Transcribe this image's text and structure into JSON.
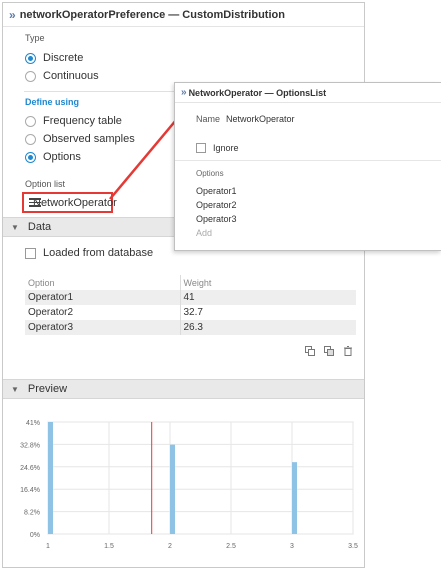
{
  "main_panel": {
    "title": "networkOperatorPreference — CustomDistribution",
    "type_label": "Type",
    "type_options": [
      {
        "label": "Discrete",
        "selected": true
      },
      {
        "label": "Continuous",
        "selected": false
      }
    ],
    "define_label": "Define using",
    "define_options": [
      {
        "label": "Frequency table",
        "selected": false
      },
      {
        "label": "Observed samples",
        "selected": false
      },
      {
        "label": "Options",
        "selected": true
      }
    ],
    "option_list_label": "Option list",
    "option_list_value": "NetworkOperator"
  },
  "data_section": {
    "title": "Data",
    "loaded_from_db_label": "Loaded from database",
    "loaded_from_db_checked": false,
    "table": {
      "headers": [
        "Option",
        "Weight"
      ],
      "rows": [
        [
          "Operator1",
          "41"
        ],
        [
          "Operator2",
          "32.7"
        ],
        [
          "Operator3",
          "26.3"
        ]
      ]
    }
  },
  "preview_section": {
    "title": "Preview"
  },
  "chart_data": {
    "type": "bar",
    "x": [
      1,
      2,
      3
    ],
    "values": [
      41,
      32.7,
      26.3
    ],
    "xlim": [
      1,
      3.5
    ],
    "ylim": [
      0,
      41
    ],
    "x_ticks": [
      "1",
      "1.5",
      "2",
      "2.5",
      "3",
      "3.5"
    ],
    "y_ticks": [
      "41%",
      "32.8%",
      "24.6%",
      "16.4%",
      "8.2%",
      "0%"
    ],
    "reference_line_x": 1.85,
    "grid": true,
    "bar_color": "#8ec3e6",
    "reference_line_color": "#e53935"
  },
  "popup": {
    "title": "NetworkOperator — OptionsList",
    "name_label": "Name",
    "name_value": "NetworkOperator",
    "ignore_label": "Ignore",
    "ignore_checked": false,
    "options_label": "Options",
    "options": [
      "Operator1",
      "Operator2",
      "Operator3"
    ],
    "add_label": "Add"
  },
  "colors": {
    "accent": "#1e88d0",
    "highlight": "#e53935",
    "section_bg": "#e9e9e9"
  }
}
